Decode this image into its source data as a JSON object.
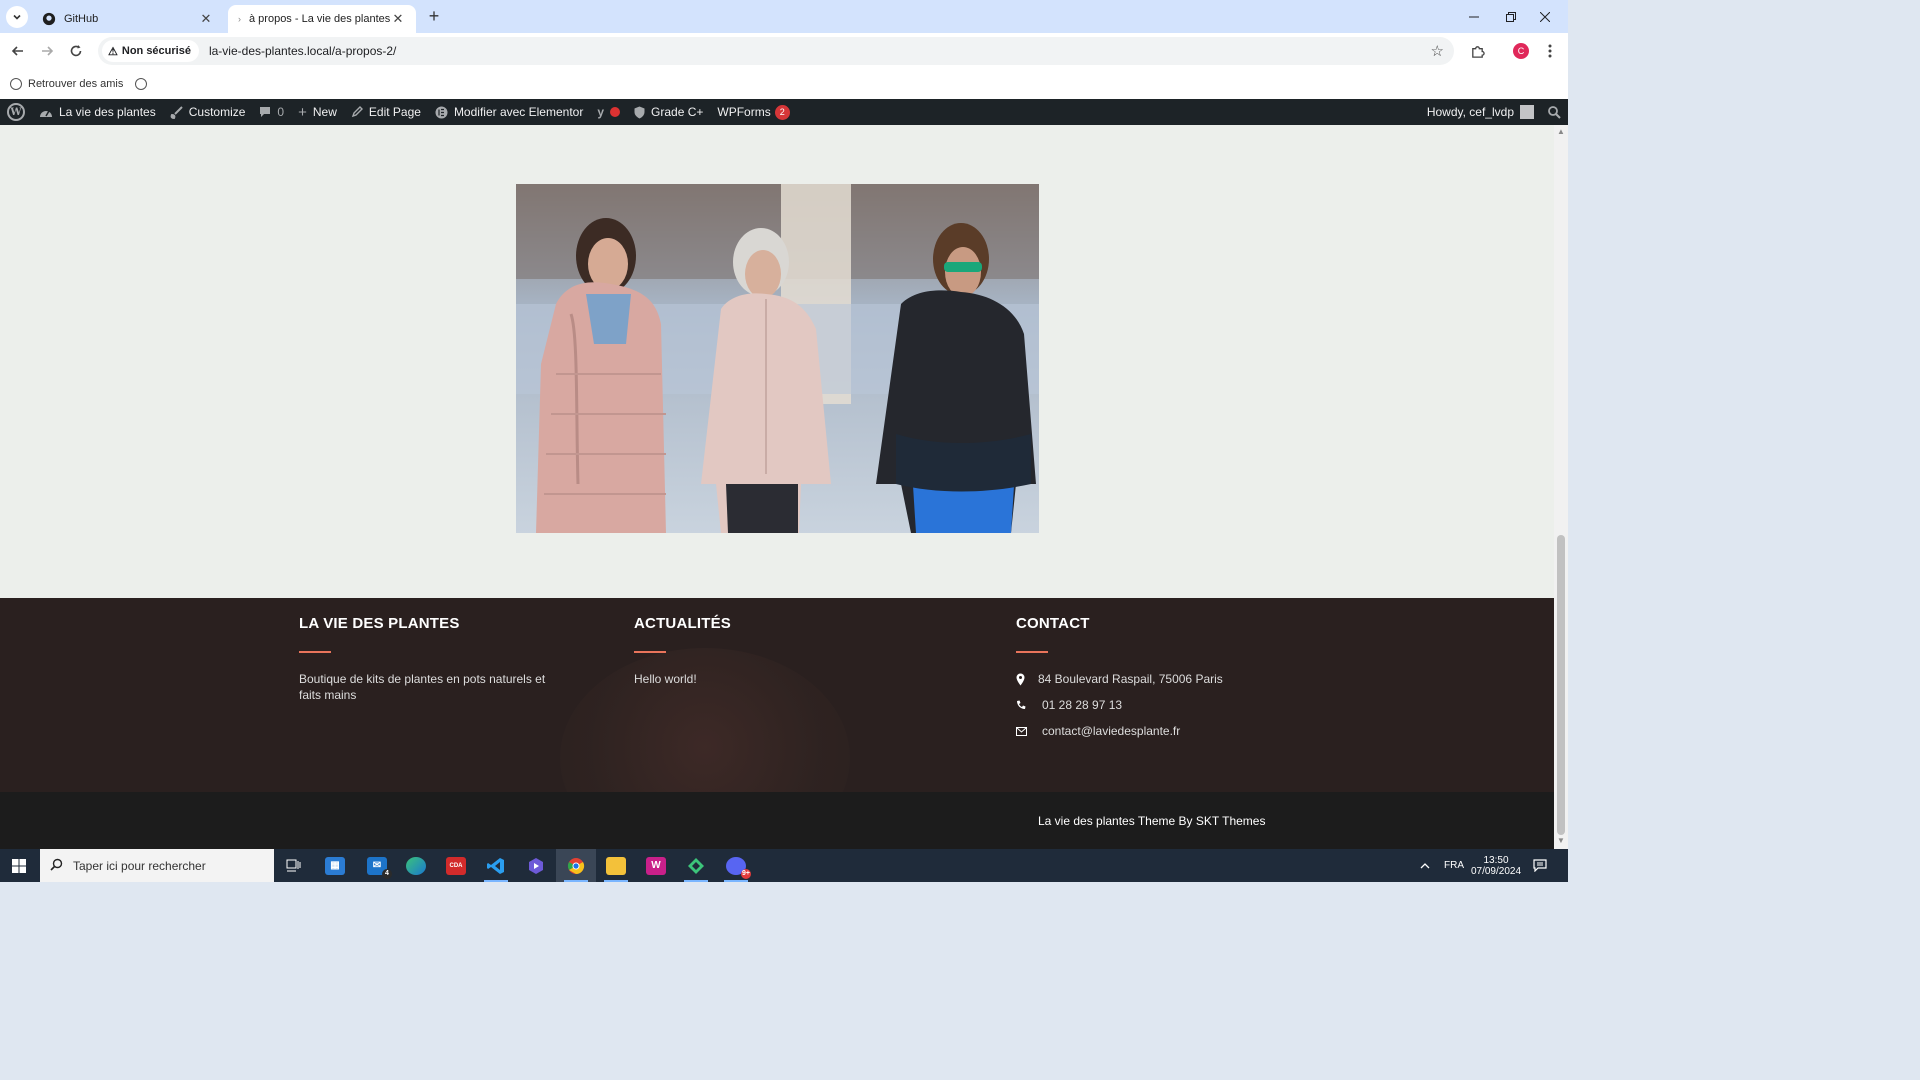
{
  "browser": {
    "tabs": [
      {
        "title": "GitHub",
        "active": false
      },
      {
        "title": "à propos - La vie des plantes",
        "active": true
      }
    ],
    "new_tab_symbol": "+",
    "omnibox": {
      "security_label": "Non sécurisé",
      "url": "la-vie-des-plantes.local/a-propos-2/"
    },
    "profile_initial": "C",
    "bookmarks": [
      {
        "label": "Retrouver des amis"
      }
    ]
  },
  "adminbar": {
    "site_name": "La vie des plantes",
    "customize": "Customize",
    "comments_count": "0",
    "new": "New",
    "edit_page": "Edit Page",
    "elementor": "Modifier avec Elementor",
    "grade": "Grade C+",
    "wpforms": "WPForms",
    "wpforms_badge": "2",
    "howdy": "Howdy, cef_lvdp"
  },
  "footer": {
    "col1": {
      "title": "LA VIE DES PLANTES",
      "text": "Boutique de kits de plantes en pots naturels et faits mains"
    },
    "col2": {
      "title": "ACTUALITÉS",
      "text": "Hello world!"
    },
    "col3": {
      "title": "CONTACT",
      "address": "84 Boulevard Raspail, 75006 Paris",
      "phone": "01 28 28 97 13",
      "email": "contact@laviedesplante.fr"
    },
    "copyright": "La vie des plantes Theme By SKT Themes"
  },
  "taskbar": {
    "search_placeholder": "Taper ici pour rechercher",
    "mail_badge": "4",
    "discord_badge": "9+",
    "language": "FRA",
    "time": "13:50",
    "date": "07/09/2024"
  },
  "colors": {
    "adminbar": "#1d2327",
    "footer": "#2a201f",
    "accent": "#e9745b",
    "tabstrip": "#d3e3fd"
  }
}
